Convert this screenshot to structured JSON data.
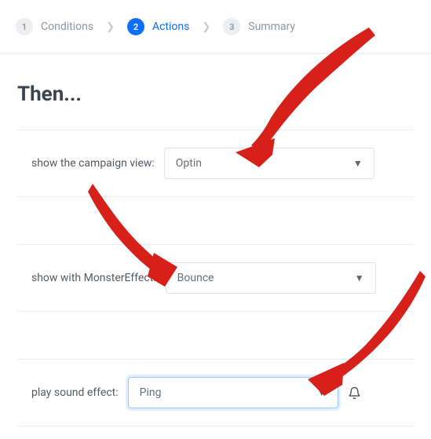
{
  "colors": {
    "accent": "#0d6efd",
    "arrow": "#d8201b"
  },
  "stepper": {
    "conditions": {
      "number": "1",
      "label": "Conditions"
    },
    "actions": {
      "number": "2",
      "label": "Actions"
    },
    "summary": {
      "number": "3",
      "label": "Summary"
    }
  },
  "heading": "Then...",
  "rows": {
    "campaign_view": {
      "label": "show the campaign view:",
      "value": "Optin"
    },
    "monster_effect": {
      "label": "show with MonsterEffect:",
      "value": "Bounce"
    },
    "sound_effect": {
      "label": "play sound effect:",
      "value": "Ping"
    }
  }
}
